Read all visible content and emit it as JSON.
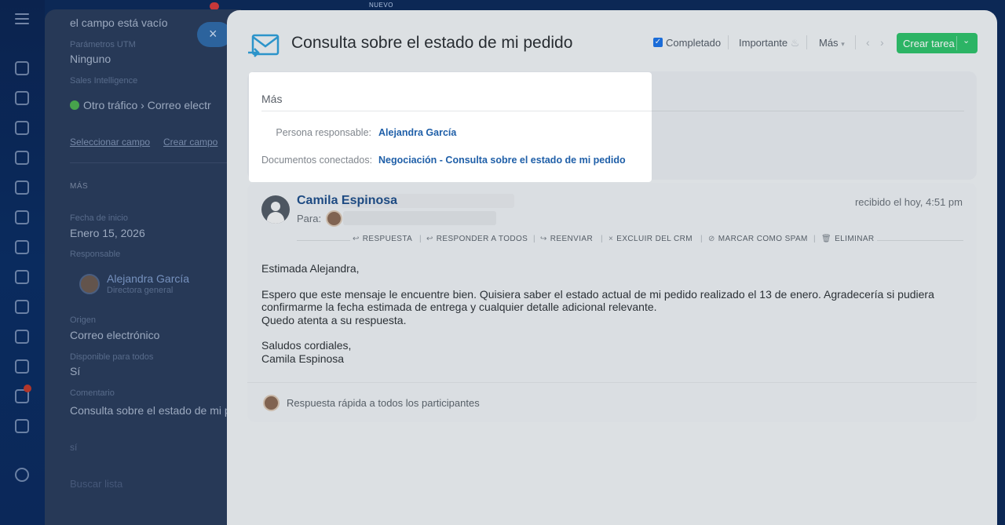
{
  "background_crm": {
    "top_text": "el campo está vacío",
    "utm_label": "Parámetros UTM",
    "utm_value": "Ninguno",
    "sales_label": "Sales Intelligence",
    "sales_value": "Otro tráfico",
    "sales_value_2": "Correo electr",
    "select_field_link": "Seleccionar campo",
    "create_field_link": "Crear campo",
    "more_section": "MÁS",
    "start_date_label": "Fecha de inicio",
    "start_date_value": "Enero 15, 2026",
    "responsible_label": "Responsable",
    "responsible_name": "Alejandra García",
    "responsible_role": "Directora general",
    "origin_label": "Origen",
    "origin_value": "Correo electrónico",
    "available_label": "Disponible para todos",
    "available_value": "Sí",
    "comment_label": "Comentario",
    "comment_value": "Consulta sobre el estado de mi p",
    "extra_value": "sí",
    "extra_value_2": "Buscar lista"
  },
  "new_badge": "NUEVO",
  "close_label": "×",
  "header": {
    "title": "Consulta sobre el estado de mi pedido",
    "completed_label": "Completado",
    "important_label": "Importante",
    "more_label": "Más",
    "create_task_label": "Crear tarea"
  },
  "popup": {
    "title": "Más",
    "responsible_label": "Persona responsable:",
    "responsible_value": "Alejandra García",
    "documents_label": "Documentos conectados:",
    "documents_value": "Negociación - Consulta sobre el estado de mi pedido"
  },
  "email": {
    "sender": "Camila Espinosa",
    "to_label": "Para:",
    "received": "recibido el hoy, 4:51 pm",
    "actions": {
      "reply": "RESPUESTA",
      "reply_all": "RESPONDER A TODOS",
      "forward": "REENVIAR",
      "exclude": "EXCLUIR DEL CRM",
      "spam": "MARCAR COMO SPAM",
      "delete": "ELIMINAR"
    },
    "greeting": "Estimada Alejandra,",
    "body_line_1": "Espero que este mensaje le encuentre bien. Quisiera saber el estado actual de mi pedido realizado el 13 de enero. Agradecería si pudiera confirmarme la fecha estimada de entrega y cualquier detalle adicional relevante.",
    "body_line_2": "Quedo atenta a su respuesta.",
    "closing": "Saludos cordiales,",
    "signature": "Camila Espinosa",
    "quick_reply": "Respuesta rápida a todos los participantes"
  },
  "colors": {
    "accent_blue": "#1f5fa8",
    "create_button": "#2fc26b",
    "checkbox": "#1c73e8"
  }
}
